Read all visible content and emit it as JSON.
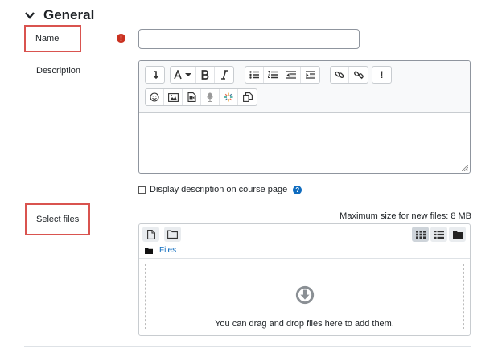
{
  "section": {
    "title": "General",
    "icon": "chevron-down-icon"
  },
  "name_field": {
    "label": "Name",
    "value": "",
    "placeholder": "",
    "required_icon": "exclamation-circle-icon",
    "required_symbol": "!"
  },
  "description": {
    "label": "Description"
  },
  "editor_toolbar": {
    "row1": [
      {
        "group": "style",
        "buttons": [
          {
            "icon": "paragraph-return-icon",
            "glyph": "↵"
          }
        ]
      },
      {
        "group": "format",
        "buttons": [
          {
            "icon": "font-color-icon",
            "glyph": "A"
          },
          {
            "icon": "bold-icon",
            "glyph": "B"
          },
          {
            "icon": "italic-icon",
            "glyph": "I"
          }
        ]
      },
      {
        "group": "lists",
        "buttons": [
          {
            "icon": "bullet-list-icon"
          },
          {
            "icon": "numbered-list-icon"
          },
          {
            "icon": "outdent-icon"
          },
          {
            "icon": "indent-icon"
          }
        ]
      },
      {
        "group": "links",
        "buttons": [
          {
            "icon": "link-icon"
          },
          {
            "icon": "unlink-icon"
          }
        ]
      },
      {
        "group": "misc",
        "buttons": [
          {
            "icon": "exclamation-icon",
            "glyph": "!"
          }
        ]
      }
    ],
    "row2": [
      {
        "group": "insert",
        "buttons": [
          {
            "icon": "emoji-icon"
          },
          {
            "icon": "image-icon"
          },
          {
            "icon": "media-icon"
          },
          {
            "icon": "microphone-icon"
          },
          {
            "icon": "video-record-icon"
          },
          {
            "icon": "copy-icon"
          }
        ]
      }
    ]
  },
  "display_description": {
    "label": "Display description on course page",
    "checked": false,
    "help_icon": "question-circle-icon",
    "help_symbol": "?"
  },
  "select_files": {
    "label": "Select files",
    "max_size": "Maximum size for new files: 8 MB"
  },
  "filemanager": {
    "path_label": "Files",
    "drop_text": "You can drag and drop files here to add them.",
    "buttons_left": [
      "add-file-icon",
      "create-folder-icon"
    ],
    "view_buttons": [
      "grid-view-icon",
      "list-view-icon",
      "tree-view-icon"
    ],
    "selected_view": "grid-view-icon"
  },
  "colors": {
    "required": "#ca3120",
    "highlight_box": "#d9534f",
    "link": "#0f6cbf"
  }
}
